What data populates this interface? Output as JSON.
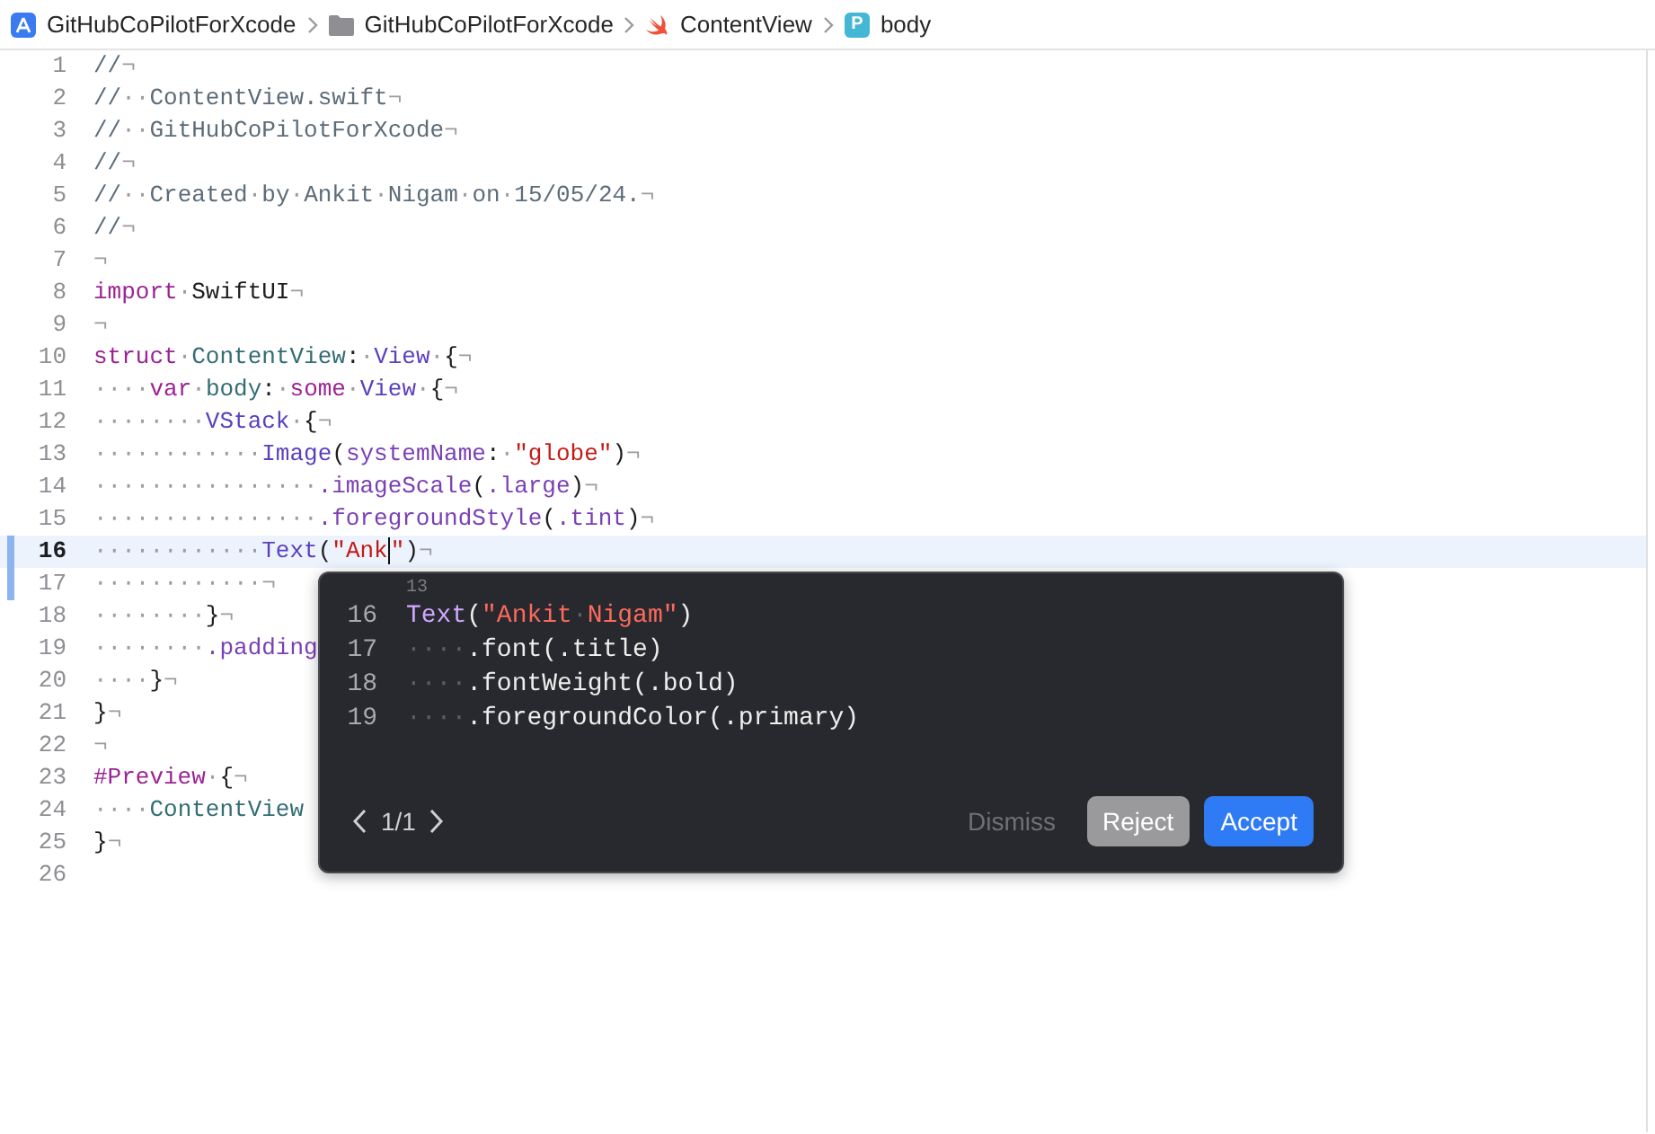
{
  "breadcrumb": [
    {
      "kind": "app",
      "label": "GitHubCoPilotForXcode"
    },
    {
      "kind": "folder",
      "label": "GitHubCoPilotForXcode"
    },
    {
      "kind": "swift",
      "label": "ContentView"
    },
    {
      "kind": "property",
      "badge": "P",
      "label": "body"
    }
  ],
  "editor": {
    "lines": [
      {
        "number": "1",
        "active": false,
        "changed": false,
        "tokens": [
          {
            "kind": "comment",
            "text": "//"
          },
          {
            "kind": "ws",
            "text": "¬"
          }
        ]
      },
      {
        "number": "2",
        "active": false,
        "changed": false,
        "tokens": [
          {
            "kind": "comment",
            "text": "//"
          },
          {
            "kind": "ws",
            "text": "··"
          },
          {
            "kind": "comment",
            "text": "ContentView.swift"
          },
          {
            "kind": "ws",
            "text": "¬"
          }
        ]
      },
      {
        "number": "3",
        "active": false,
        "changed": false,
        "tokens": [
          {
            "kind": "comment",
            "text": "//"
          },
          {
            "kind": "ws",
            "text": "··"
          },
          {
            "kind": "comment",
            "text": "GitHubCoPilotForXcode"
          },
          {
            "kind": "ws",
            "text": "¬"
          }
        ]
      },
      {
        "number": "4",
        "active": false,
        "changed": false,
        "tokens": [
          {
            "kind": "comment",
            "text": "//"
          },
          {
            "kind": "ws",
            "text": "¬"
          }
        ]
      },
      {
        "number": "5",
        "active": false,
        "changed": false,
        "tokens": [
          {
            "kind": "comment",
            "text": "//"
          },
          {
            "kind": "ws",
            "text": "··"
          },
          {
            "kind": "comment",
            "text": "Created"
          },
          {
            "kind": "ws",
            "text": "·"
          },
          {
            "kind": "comment",
            "text": "by"
          },
          {
            "kind": "ws",
            "text": "·"
          },
          {
            "kind": "comment",
            "text": "Ankit"
          },
          {
            "kind": "ws",
            "text": "·"
          },
          {
            "kind": "comment",
            "text": "Nigam"
          },
          {
            "kind": "ws",
            "text": "·"
          },
          {
            "kind": "comment",
            "text": "on"
          },
          {
            "kind": "ws",
            "text": "·"
          },
          {
            "kind": "comment",
            "text": "15/05/24."
          },
          {
            "kind": "ws",
            "text": "¬"
          }
        ]
      },
      {
        "number": "6",
        "active": false,
        "changed": false,
        "tokens": [
          {
            "kind": "comment",
            "text": "//"
          },
          {
            "kind": "ws",
            "text": "¬"
          }
        ]
      },
      {
        "number": "7",
        "active": false,
        "changed": false,
        "tokens": [
          {
            "kind": "ws",
            "text": "¬"
          }
        ]
      },
      {
        "number": "8",
        "active": false,
        "changed": false,
        "tokens": [
          {
            "kind": "keyword",
            "text": "import"
          },
          {
            "kind": "ws",
            "text": "·"
          },
          {
            "kind": "plain",
            "text": "SwiftUI"
          },
          {
            "kind": "ws",
            "text": "¬"
          }
        ]
      },
      {
        "number": "9",
        "active": false,
        "changed": false,
        "tokens": [
          {
            "kind": "ws",
            "text": "¬"
          }
        ]
      },
      {
        "number": "10",
        "active": false,
        "changed": false,
        "tokens": [
          {
            "kind": "keyword",
            "text": "struct"
          },
          {
            "kind": "ws",
            "text": "·"
          },
          {
            "kind": "declaration",
            "text": "ContentView"
          },
          {
            "kind": "plain",
            "text": ":"
          },
          {
            "kind": "ws",
            "text": "·"
          },
          {
            "kind": "type",
            "text": "View"
          },
          {
            "kind": "ws",
            "text": "·"
          },
          {
            "kind": "plain",
            "text": "{"
          },
          {
            "kind": "ws",
            "text": "¬"
          }
        ]
      },
      {
        "number": "11",
        "active": false,
        "changed": false,
        "tokens": [
          {
            "kind": "ws",
            "text": "····"
          },
          {
            "kind": "keyword",
            "text": "var"
          },
          {
            "kind": "ws",
            "text": "·"
          },
          {
            "kind": "declaration",
            "text": "body"
          },
          {
            "kind": "plain",
            "text": ":"
          },
          {
            "kind": "ws",
            "text": "·"
          },
          {
            "kind": "keyword",
            "text": "some"
          },
          {
            "kind": "ws",
            "text": "·"
          },
          {
            "kind": "type",
            "text": "View"
          },
          {
            "kind": "ws",
            "text": "·"
          },
          {
            "kind": "plain",
            "text": "{"
          },
          {
            "kind": "ws",
            "text": "¬"
          }
        ]
      },
      {
        "number": "12",
        "active": false,
        "changed": false,
        "tokens": [
          {
            "kind": "ws",
            "text": "········"
          },
          {
            "kind": "type",
            "text": "VStack"
          },
          {
            "kind": "ws",
            "text": "·"
          },
          {
            "kind": "plain",
            "text": "{"
          },
          {
            "kind": "ws",
            "text": "¬"
          }
        ]
      },
      {
        "number": "13",
        "active": false,
        "changed": false,
        "tokens": [
          {
            "kind": "ws",
            "text": "············"
          },
          {
            "kind": "type",
            "text": "Image"
          },
          {
            "kind": "plain",
            "text": "("
          },
          {
            "kind": "method",
            "text": "systemName"
          },
          {
            "kind": "plain",
            "text": ":"
          },
          {
            "kind": "ws",
            "text": "·"
          },
          {
            "kind": "string",
            "text": "\"globe\""
          },
          {
            "kind": "plain",
            "text": ")"
          },
          {
            "kind": "ws",
            "text": "¬"
          }
        ]
      },
      {
        "number": "14",
        "active": false,
        "changed": false,
        "tokens": [
          {
            "kind": "ws",
            "text": "················"
          },
          {
            "kind": "method",
            "text": ".imageScale"
          },
          {
            "kind": "plain",
            "text": "("
          },
          {
            "kind": "method",
            "text": ".large"
          },
          {
            "kind": "plain",
            "text": ")"
          },
          {
            "kind": "ws",
            "text": "¬"
          }
        ]
      },
      {
        "number": "15",
        "active": false,
        "changed": false,
        "tokens": [
          {
            "kind": "ws",
            "text": "················"
          },
          {
            "kind": "method",
            "text": ".foregroundStyle"
          },
          {
            "kind": "plain",
            "text": "("
          },
          {
            "kind": "method",
            "text": ".tint"
          },
          {
            "kind": "plain",
            "text": ")"
          },
          {
            "kind": "ws",
            "text": "¬"
          }
        ]
      },
      {
        "number": "16",
        "active": true,
        "changed": true,
        "tokens": [
          {
            "kind": "ws",
            "text": "············"
          },
          {
            "kind": "type",
            "text": "Text"
          },
          {
            "kind": "plain",
            "text": "("
          },
          {
            "kind": "string",
            "text": "\"Ank"
          },
          {
            "kind": "cursor"
          },
          {
            "kind": "string",
            "text": "\""
          },
          {
            "kind": "plain",
            "text": ")"
          },
          {
            "kind": "ws",
            "text": "¬"
          }
        ]
      },
      {
        "number": "17",
        "active": false,
        "changed": true,
        "tokens": [
          {
            "kind": "ws",
            "text": "············¬"
          }
        ]
      },
      {
        "number": "18",
        "active": false,
        "changed": false,
        "tokens": [
          {
            "kind": "ws",
            "text": "········"
          },
          {
            "kind": "plain",
            "text": "}"
          },
          {
            "kind": "ws",
            "text": "¬"
          }
        ]
      },
      {
        "number": "19",
        "active": false,
        "changed": false,
        "tokens": [
          {
            "kind": "ws",
            "text": "········"
          },
          {
            "kind": "method",
            "text": ".padding"
          }
        ]
      },
      {
        "number": "20",
        "active": false,
        "changed": false,
        "tokens": [
          {
            "kind": "ws",
            "text": "····"
          },
          {
            "kind": "plain",
            "text": "}"
          },
          {
            "kind": "ws",
            "text": "¬"
          }
        ]
      },
      {
        "number": "21",
        "active": false,
        "changed": false,
        "tokens": [
          {
            "kind": "plain",
            "text": "}"
          },
          {
            "kind": "ws",
            "text": "¬"
          }
        ]
      },
      {
        "number": "22",
        "active": false,
        "changed": false,
        "tokens": [
          {
            "kind": "ws",
            "text": "¬"
          }
        ]
      },
      {
        "number": "23",
        "active": false,
        "changed": false,
        "tokens": [
          {
            "kind": "keyword",
            "text": "#Preview"
          },
          {
            "kind": "ws",
            "text": "·"
          },
          {
            "kind": "plain",
            "text": "{"
          },
          {
            "kind": "ws",
            "text": "¬"
          }
        ]
      },
      {
        "number": "24",
        "active": false,
        "changed": false,
        "tokens": [
          {
            "kind": "ws",
            "text": "····"
          },
          {
            "kind": "declaration",
            "text": "ContentView"
          }
        ]
      },
      {
        "number": "25",
        "active": false,
        "changed": false,
        "tokens": [
          {
            "kind": "plain",
            "text": "}"
          },
          {
            "kind": "ws",
            "text": "¬"
          }
        ]
      },
      {
        "number": "26",
        "active": false,
        "changed": false
      }
    ]
  },
  "suggestion": {
    "caption": "13",
    "lines": [
      {
        "number": "16",
        "tokens": [
          {
            "kind": "type",
            "text": "Text"
          },
          {
            "kind": "plain",
            "text": "("
          },
          {
            "kind": "string",
            "text": "\"Ankit"
          },
          {
            "kind": "ws",
            "text": "·"
          },
          {
            "kind": "string",
            "text": "Nigam\""
          },
          {
            "kind": "plain",
            "text": ")"
          }
        ]
      },
      {
        "number": "17",
        "tokens": [
          {
            "kind": "ws",
            "text": "····"
          },
          {
            "kind": "plain",
            "text": ".font(.title)"
          }
        ]
      },
      {
        "number": "18",
        "tokens": [
          {
            "kind": "ws",
            "text": "····"
          },
          {
            "kind": "plain",
            "text": ".fontWeight(.bold)"
          }
        ]
      },
      {
        "number": "19",
        "tokens": [
          {
            "kind": "ws",
            "text": "····"
          },
          {
            "kind": "plain",
            "text": ".foregroundColor(.primary)"
          }
        ]
      }
    ],
    "counter": "1/1",
    "buttons": [
      {
        "kind": "link",
        "label": "Dismiss"
      },
      {
        "kind": "secondary",
        "label": "Reject"
      },
      {
        "kind": "primary",
        "label": "Accept"
      }
    ]
  }
}
